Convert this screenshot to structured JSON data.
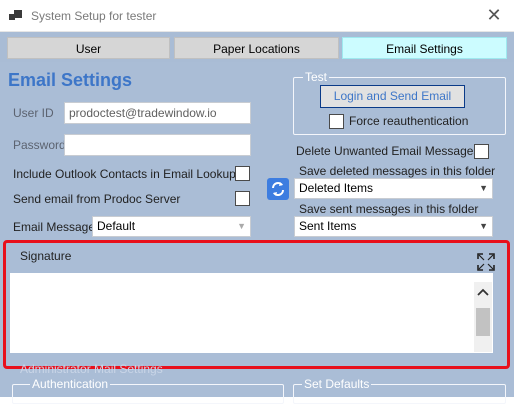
{
  "window": {
    "title": "System Setup for tester",
    "close_glyph": "✕",
    "icon": "app-icon"
  },
  "tabs": [
    {
      "label": "User",
      "active": false
    },
    {
      "label": "Paper Locations",
      "active": false
    },
    {
      "label": "Email Settings",
      "active": true
    }
  ],
  "email_settings": {
    "heading": "Email Settings",
    "user_id_label": "User ID",
    "user_id_value": "prodoctest@tradewindow.io",
    "password_label": "Password",
    "password_value": "",
    "include_contacts_label": "Include Outlook Contacts in Email Lookup",
    "include_contacts_checked": false,
    "send_from_server_label": "Send email from Prodoc Server",
    "send_from_server_checked": false,
    "email_message_label": "Email Message",
    "email_message_value": "Default"
  },
  "test_group": {
    "title": "Test",
    "login_button": "Login and Send Email",
    "force_reauth_label": "Force reauthentication",
    "force_reauth_checked": false
  },
  "folders": {
    "delete_unwanted_label": "Delete Unwanted Email Messages",
    "delete_unwanted_checked": false,
    "save_deleted_label": "Save deleted messages in this folder",
    "save_deleted_value": "Deleted Items",
    "save_sent_label": "Save sent messages in this folder",
    "save_sent_value": "Sent Items",
    "sync_icon": "sync-icon"
  },
  "signature": {
    "label": "Signature",
    "value": "",
    "expand_icon": "expand-icon",
    "scroll_up_glyph": "⌃"
  },
  "admin": {
    "title": "Administrator Mail Settings",
    "authentication_label": "Authentication",
    "set_defaults_label": "Set Defaults"
  },
  "colors": {
    "accent": "#3d76c8",
    "panel": "#aabdd6",
    "active_tab": "#ccfcff",
    "highlight": "#e8101c"
  }
}
